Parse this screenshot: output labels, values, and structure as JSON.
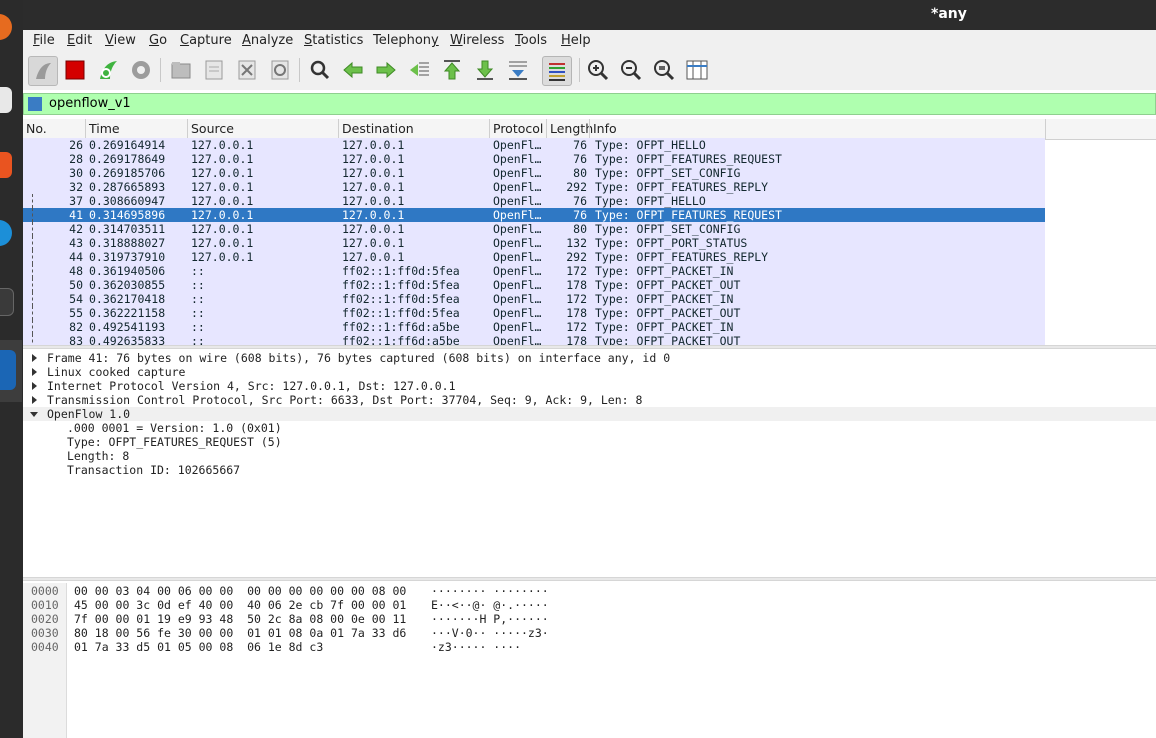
{
  "window": {
    "title": "*any"
  },
  "menu": {
    "items": [
      {
        "label": "File",
        "ul": "F",
        "rest": "ile"
      },
      {
        "label": "Edit",
        "ul": "E",
        "rest": "dit"
      },
      {
        "label": "View",
        "ul": "V",
        "rest": "iew"
      },
      {
        "label": "Go",
        "ul": "G",
        "rest": "o"
      },
      {
        "label": "Capture",
        "ul": "C",
        "rest": "apture"
      },
      {
        "label": "Analyze",
        "ul": "A",
        "rest": "nalyze"
      },
      {
        "label": "Statistics",
        "ul": "S",
        "rest": "tatistics"
      },
      {
        "label": "Telephony",
        "ul": "y",
        "rest": "Telephon"
      },
      {
        "label": "Wireless",
        "ul": "W",
        "rest": "ireless"
      },
      {
        "label": "Tools",
        "ul": "T",
        "rest": "ools"
      },
      {
        "label": "Help",
        "ul": "H",
        "rest": "elp"
      }
    ]
  },
  "toolbar": {
    "icons": [
      "start-capture-icon",
      "stop-capture-icon",
      "restart-capture-icon",
      "capture-options-icon",
      "open-file-icon",
      "save-file-icon",
      "close-file-icon",
      "reload-file-icon",
      "find-packet-icon",
      "go-back-icon",
      "go-forward-icon",
      "go-to-packet-icon",
      "first-packet-icon",
      "last-packet-icon",
      "autoscroll-icon",
      "colorize-icon",
      "zoom-in-icon",
      "zoom-out-icon",
      "normal-size-icon",
      "resize-columns-icon"
    ]
  },
  "filter": {
    "value": "openflow_v1"
  },
  "packet_list": {
    "columns": [
      "No.",
      "Time",
      "Source",
      "Destination",
      "Protocol",
      "Length",
      "Info"
    ],
    "selected_no": "41",
    "rows": [
      {
        "no": "26",
        "time": "0.269164914",
        "src": "127.0.0.1",
        "dst": "127.0.0.1",
        "proto": "OpenFl…",
        "len": "76",
        "info": "Type: OFPT_HELLO"
      },
      {
        "no": "28",
        "time": "0.269178649",
        "src": "127.0.0.1",
        "dst": "127.0.0.1",
        "proto": "OpenFl…",
        "len": "76",
        "info": "Type: OFPT_FEATURES_REQUEST"
      },
      {
        "no": "30",
        "time": "0.269185706",
        "src": "127.0.0.1",
        "dst": "127.0.0.1",
        "proto": "OpenFl…",
        "len": "80",
        "info": "Type: OFPT_SET_CONFIG"
      },
      {
        "no": "32",
        "time": "0.287665893",
        "src": "127.0.0.1",
        "dst": "127.0.0.1",
        "proto": "OpenFl…",
        "len": "292",
        "info": "Type: OFPT_FEATURES_REPLY"
      },
      {
        "no": "37",
        "time": "0.308660947",
        "src": "127.0.0.1",
        "dst": "127.0.0.1",
        "proto": "OpenFl…",
        "len": "76",
        "info": "Type: OFPT_HELLO"
      },
      {
        "no": "41",
        "time": "0.314695896",
        "src": "127.0.0.1",
        "dst": "127.0.0.1",
        "proto": "OpenFl…",
        "len": "76",
        "info": "Type: OFPT_FEATURES_REQUEST"
      },
      {
        "no": "42",
        "time": "0.314703511",
        "src": "127.0.0.1",
        "dst": "127.0.0.1",
        "proto": "OpenFl…",
        "len": "80",
        "info": "Type: OFPT_SET_CONFIG"
      },
      {
        "no": "43",
        "time": "0.318888027",
        "src": "127.0.0.1",
        "dst": "127.0.0.1",
        "proto": "OpenFl…",
        "len": "132",
        "info": "Type: OFPT_PORT_STATUS"
      },
      {
        "no": "44",
        "time": "0.319737910",
        "src": "127.0.0.1",
        "dst": "127.0.0.1",
        "proto": "OpenFl…",
        "len": "292",
        "info": "Type: OFPT_FEATURES_REPLY"
      },
      {
        "no": "48",
        "time": "0.361940506",
        "src": "::",
        "dst": "ff02::1:ff0d:5fea",
        "proto": "OpenFl…",
        "len": "172",
        "info": "Type: OFPT_PACKET_IN"
      },
      {
        "no": "50",
        "time": "0.362030855",
        "src": "::",
        "dst": "ff02::1:ff0d:5fea",
        "proto": "OpenFl…",
        "len": "178",
        "info": "Type: OFPT_PACKET_OUT"
      },
      {
        "no": "54",
        "time": "0.362170418",
        "src": "::",
        "dst": "ff02::1:ff0d:5fea",
        "proto": "OpenFl…",
        "len": "172",
        "info": "Type: OFPT_PACKET_IN"
      },
      {
        "no": "55",
        "time": "0.362221158",
        "src": "::",
        "dst": "ff02::1:ff0d:5fea",
        "proto": "OpenFl…",
        "len": "178",
        "info": "Type: OFPT_PACKET_OUT"
      },
      {
        "no": "82",
        "time": "0.492541193",
        "src": "::",
        "dst": "ff02::1:ff6d:a5be",
        "proto": "OpenFl…",
        "len": "172",
        "info": "Type: OFPT_PACKET_IN"
      },
      {
        "no": "83",
        "time": "0.492635833",
        "src": "::",
        "dst": "ff02::1:ff6d:a5be",
        "proto": "OpenFl…",
        "len": "178",
        "info": "Type: OFPT_PACKET_OUT"
      }
    ]
  },
  "details": {
    "items": [
      {
        "text": "Frame 41: 76 bytes on wire (608 bits), 76 bytes captured (608 bits) on interface any, id 0",
        "level": 0,
        "state": "collapsed"
      },
      {
        "text": "Linux cooked capture",
        "level": 0,
        "state": "collapsed"
      },
      {
        "text": "Internet Protocol Version 4, Src: 127.0.0.1, Dst: 127.0.0.1",
        "level": 0,
        "state": "collapsed"
      },
      {
        "text": "Transmission Control Protocol, Src Port: 6633, Dst Port: 37704, Seq: 9, Ack: 9, Len: 8",
        "level": 0,
        "state": "collapsed"
      },
      {
        "text": "OpenFlow 1.0",
        "level": 0,
        "state": "expanded"
      },
      {
        "text": ".000 0001 = Version: 1.0 (0x01)",
        "level": 1,
        "state": "leaf"
      },
      {
        "text": "Type: OFPT_FEATURES_REQUEST (5)",
        "level": 1,
        "state": "leaf"
      },
      {
        "text": "Length: 8",
        "level": 1,
        "state": "leaf"
      },
      {
        "text": "Transaction ID: 102665667",
        "level": 1,
        "state": "leaf"
      }
    ]
  },
  "bytes": {
    "rows": [
      {
        "offset": "0000",
        "hex": "00 00 03 04 00 06 00 00  00 00 00 00 00 00 08 00",
        "ascii": "········ ········"
      },
      {
        "offset": "0010",
        "hex": "45 00 00 3c 0d ef 40 00  40 06 2e cb 7f 00 00 01",
        "ascii": "E··<··@· @·.·····"
      },
      {
        "offset": "0020",
        "hex": "7f 00 00 01 19 e9 93 48  50 2c 8a 08 00 0e 00 11",
        "ascii": "·······H P,······"
      },
      {
        "offset": "0030",
        "hex": "80 18 00 56 fe 30 00 00  01 01 08 0a 01 7a 33 d6",
        "ascii": "···V·0·· ·····z3·"
      },
      {
        "offset": "0040",
        "hex": "01 7a 33 d5 01 05 00 08  06 1e 8d c3",
        "ascii": "·z3····· ····"
      }
    ]
  },
  "colors": {
    "filter_bg": "#afffaf",
    "row_bg": "#e7e6ff",
    "selected_bg": "#2f78c4",
    "titlebar_bg": "#2c2c2c"
  }
}
